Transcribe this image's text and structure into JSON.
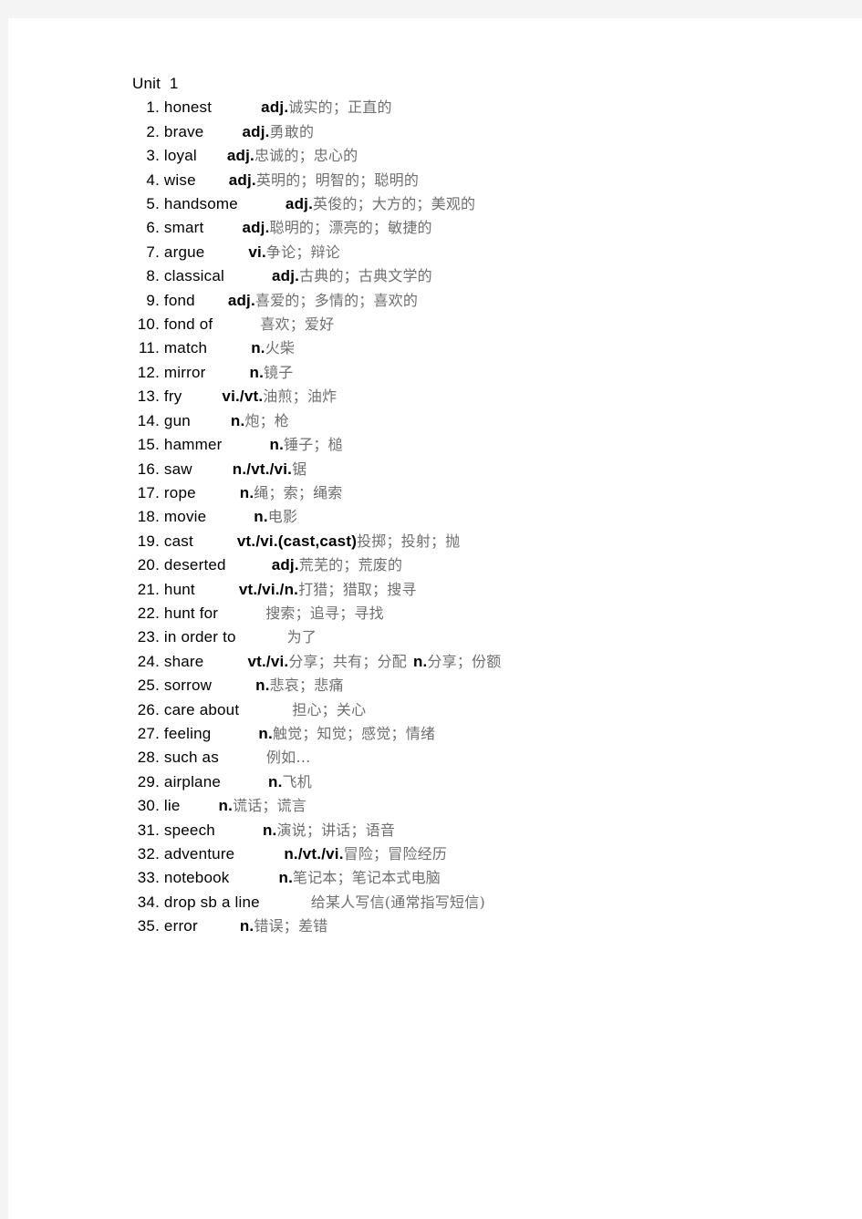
{
  "document": {
    "unit_title": "Unit  1",
    "entries": [
      {
        "num": "1.",
        "term": "honest",
        "gap": 54,
        "pos": "adj.",
        "gloss": "诚实的；正直的"
      },
      {
        "num": "2.",
        "term": "brave",
        "gap": 42,
        "pos": "adj.",
        "gloss": "勇敢的"
      },
      {
        "num": "3.",
        "term": "loyal",
        "gap": 33,
        "pos": "adj.",
        "gloss": "忠诚的；忠心的"
      },
      {
        "num": "4.",
        "term": "wise",
        "gap": 36,
        "pos": "adj.",
        "gloss": "英明的；明智的；聪明的"
      },
      {
        "num": "5.",
        "term": "handsome",
        "gap": 52,
        "pos": "adj.",
        "gloss": "英俊的；大方的；美观的"
      },
      {
        "num": "6.",
        "term": "smart",
        "gap": 42,
        "pos": "adj.",
        "gloss": "聪明的；漂亮的；敏捷的"
      },
      {
        "num": "7.",
        "term": "argue",
        "gap": 48,
        "pos": "vi.",
        "gloss": "争论；辩论"
      },
      {
        "num": "8.",
        "term": "classical",
        "gap": 52,
        "pos": "adj.",
        "gloss": "古典的；古典文学的"
      },
      {
        "num": "9.",
        "term": "fond",
        "gap": 36,
        "pos": "adj.",
        "gloss": "喜爱的；多情的；喜欢的"
      },
      {
        "num": "10.",
        "term": "fond of",
        "gap": 52,
        "pos": "",
        "gloss": "喜欢；爱好"
      },
      {
        "num": "11.",
        "term": "match",
        "gap": 48,
        "pos": "n.",
        "gloss": "火柴"
      },
      {
        "num": "12.",
        "term": "mirror",
        "gap": 48,
        "pos": "n.",
        "gloss": "镜子"
      },
      {
        "num": "13.",
        "term": "fry",
        "gap": 44,
        "pos": "vi./vt.",
        "gloss": "油煎；油炸"
      },
      {
        "num": "14.",
        "term": "gun",
        "gap": 44,
        "pos": "n.",
        "gloss": "炮；枪"
      },
      {
        "num": "15.",
        "term": "hammer",
        "gap": 52,
        "pos": "n.",
        "gloss": "锤子；槌"
      },
      {
        "num": "16.",
        "term": "saw",
        "gap": 44,
        "pos": "n./vt./vi.",
        "gloss": "锯"
      },
      {
        "num": "17.",
        "term": "rope",
        "gap": 48,
        "pos": "n.",
        "gloss": "绳；索；绳索"
      },
      {
        "num": "18.",
        "term": "movie",
        "gap": 52,
        "pos": "n.",
        "gloss": "电影"
      },
      {
        "num": "19.",
        "term": "cast",
        "gap": 48,
        "pos": "vt./vi.(cast,cast)",
        "gloss": "投掷；投射；抛"
      },
      {
        "num": "20.",
        "term": "deserted",
        "gap": 50,
        "pos": "adj.",
        "gloss": "荒芜的；荒废的"
      },
      {
        "num": "21.",
        "term": "hunt",
        "gap": 48,
        "pos": "vt./vi./n.",
        "gloss": "打猎；猎取；搜寻"
      },
      {
        "num": "22.",
        "term": "hunt for",
        "gap": 52,
        "pos": "",
        "gloss": "搜索；追寻；寻找"
      },
      {
        "num": "23.",
        "term": "in order to",
        "gap": 56,
        "pos": "",
        "gloss": "为了"
      },
      {
        "num": "24.",
        "term": "share",
        "gap": 48,
        "pos": "vt./vi.",
        "gloss": "分享；共有；分配",
        "pos2": "n.",
        "gloss2": "分享；份额"
      },
      {
        "num": "25.",
        "term": "sorrow",
        "gap": 48,
        "pos": "n.",
        "gloss": "悲哀；悲痛"
      },
      {
        "num": "26.",
        "term": "care about",
        "gap": 58,
        "pos": "",
        "gloss": "担心；关心"
      },
      {
        "num": "27.",
        "term": "feeling",
        "gap": 52,
        "pos": "n.",
        "gloss": "触觉；知觉；感觉；情绪"
      },
      {
        "num": "28.",
        "term": "such as",
        "gap": 52,
        "pos": "",
        "gloss": "例如…"
      },
      {
        "num": "29.",
        "term": "airplane",
        "gap": 52,
        "pos": "n.",
        "gloss": "飞机"
      },
      {
        "num": "30.",
        "term": "lie",
        "gap": 42,
        "pos": "n.",
        "gloss": "谎话；谎言"
      },
      {
        "num": "31.",
        "term": "speech",
        "gap": 52,
        "pos": "n.",
        "gloss": "演说；讲话；语音"
      },
      {
        "num": "32.",
        "term": "adventure",
        "gap": 54,
        "pos": "n./vt./vi.",
        "gloss": "冒险；冒险经历"
      },
      {
        "num": "33.",
        "term": "notebook",
        "gap": 54,
        "pos": "n.",
        "gloss": "笔记本；笔记本式电脑"
      },
      {
        "num": "34.",
        "term": "drop sb a line",
        "gap": 56,
        "pos": "",
        "gloss": "给某人写信(通常指写短信)"
      },
      {
        "num": "35.",
        "term": "error",
        "gap": 46,
        "pos": "n.",
        "gloss": "错误；差错"
      }
    ]
  }
}
